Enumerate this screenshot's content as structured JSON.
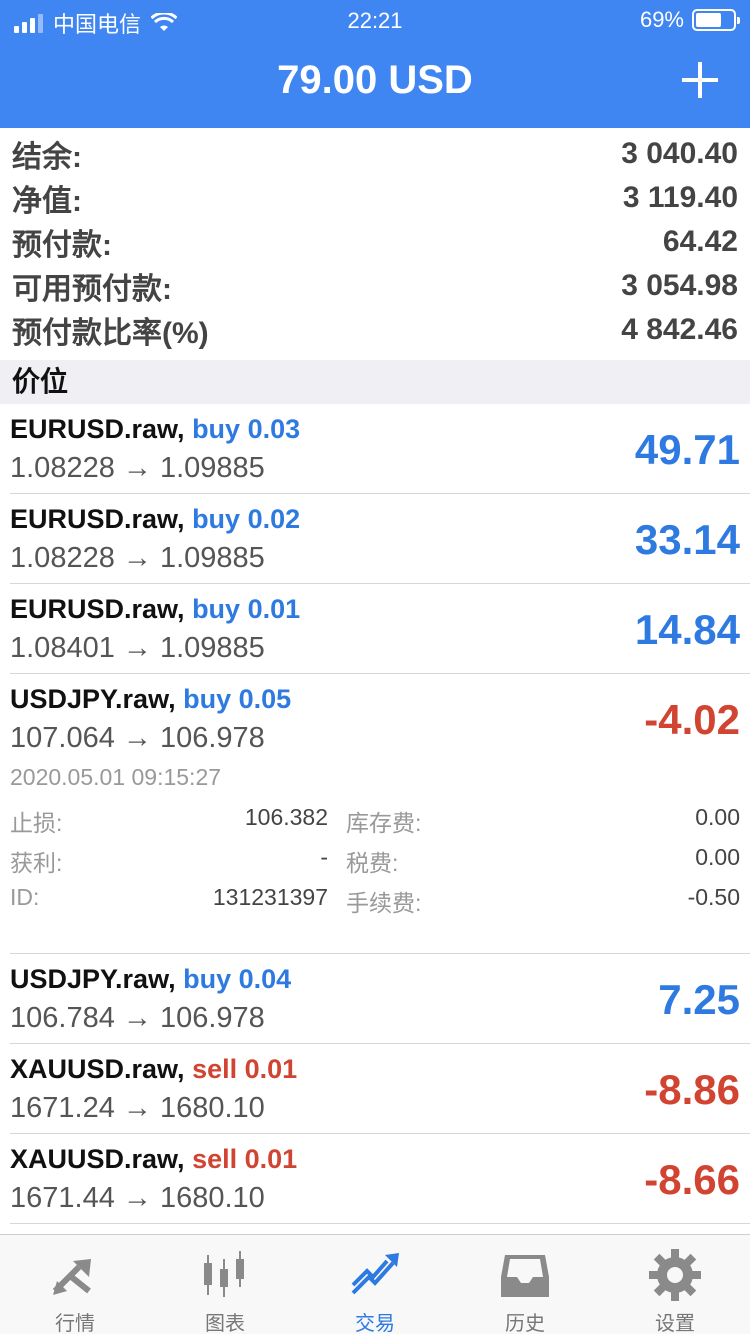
{
  "status_bar": {
    "carrier": "中国电信",
    "time": "22:21",
    "battery": "69%"
  },
  "header": {
    "title": "79.00 USD"
  },
  "summary": [
    {
      "label": "结余:",
      "value": "3 040.40"
    },
    {
      "label": "净值:",
      "value": "3 119.40"
    },
    {
      "label": "预付款:",
      "value": "64.42"
    },
    {
      "label": "可用预付款:",
      "value": "3 054.98"
    },
    {
      "label": "预付款比率(%)",
      "value": "4 842.46"
    }
  ],
  "section_title": "价位",
  "positions": [
    {
      "symbol": "EURUSD.raw,",
      "action": "buy 0.03",
      "prices": "1.08228 → 1.09885",
      "profit": "49.71"
    },
    {
      "symbol": "EURUSD.raw,",
      "action": "buy 0.02",
      "prices": "1.08228 → 1.09885",
      "profit": "33.14"
    },
    {
      "symbol": "EURUSD.raw,",
      "action": "buy 0.01",
      "prices": "1.08401 → 1.09885",
      "profit": "14.84"
    },
    {
      "symbol": "USDJPY.raw,",
      "action": "buy 0.05",
      "prices": "107.064 → 106.978",
      "profit": "-4.02"
    },
    {
      "symbol": "USDJPY.raw,",
      "action": "buy 0.04",
      "prices": "106.784 → 106.978",
      "profit": "7.25"
    },
    {
      "symbol": "XAUUSD.raw,",
      "action": "sell 0.01",
      "prices": "1671.24 → 1680.10",
      "profit": "-8.86"
    },
    {
      "symbol": "XAUUSD.raw,",
      "action": "sell 0.01",
      "prices": "1671.44 → 1680.10",
      "profit": "-8.66"
    }
  ],
  "detail": {
    "datetime": "2020.05.01 09:15:27",
    "rows": [
      {
        "label1": "止损:",
        "value1": "106.382",
        "label2": "库存费:",
        "value2": "0.00"
      },
      {
        "label1": "获利:",
        "value1": "-",
        "label2": "税费:",
        "value2": "0.00"
      },
      {
        "label1": "ID:",
        "value1": "131231397",
        "label2": "手续费:",
        "value2": "-0.50"
      }
    ]
  },
  "tabs": [
    {
      "label": "行情",
      "icon": "quotes-arrows-icon"
    },
    {
      "label": "图表",
      "icon": "candlestick-chart-icon"
    },
    {
      "label": "交易",
      "icon": "trade-trend-icon",
      "active": true
    },
    {
      "label": "历史",
      "icon": "history-tray-icon"
    },
    {
      "label": "设置",
      "icon": "settings-gear-icon"
    }
  ],
  "colors": {
    "header_blue": "#3f86f2",
    "profit_blue": "#2e7ae0",
    "loss_red": "#d24432"
  }
}
